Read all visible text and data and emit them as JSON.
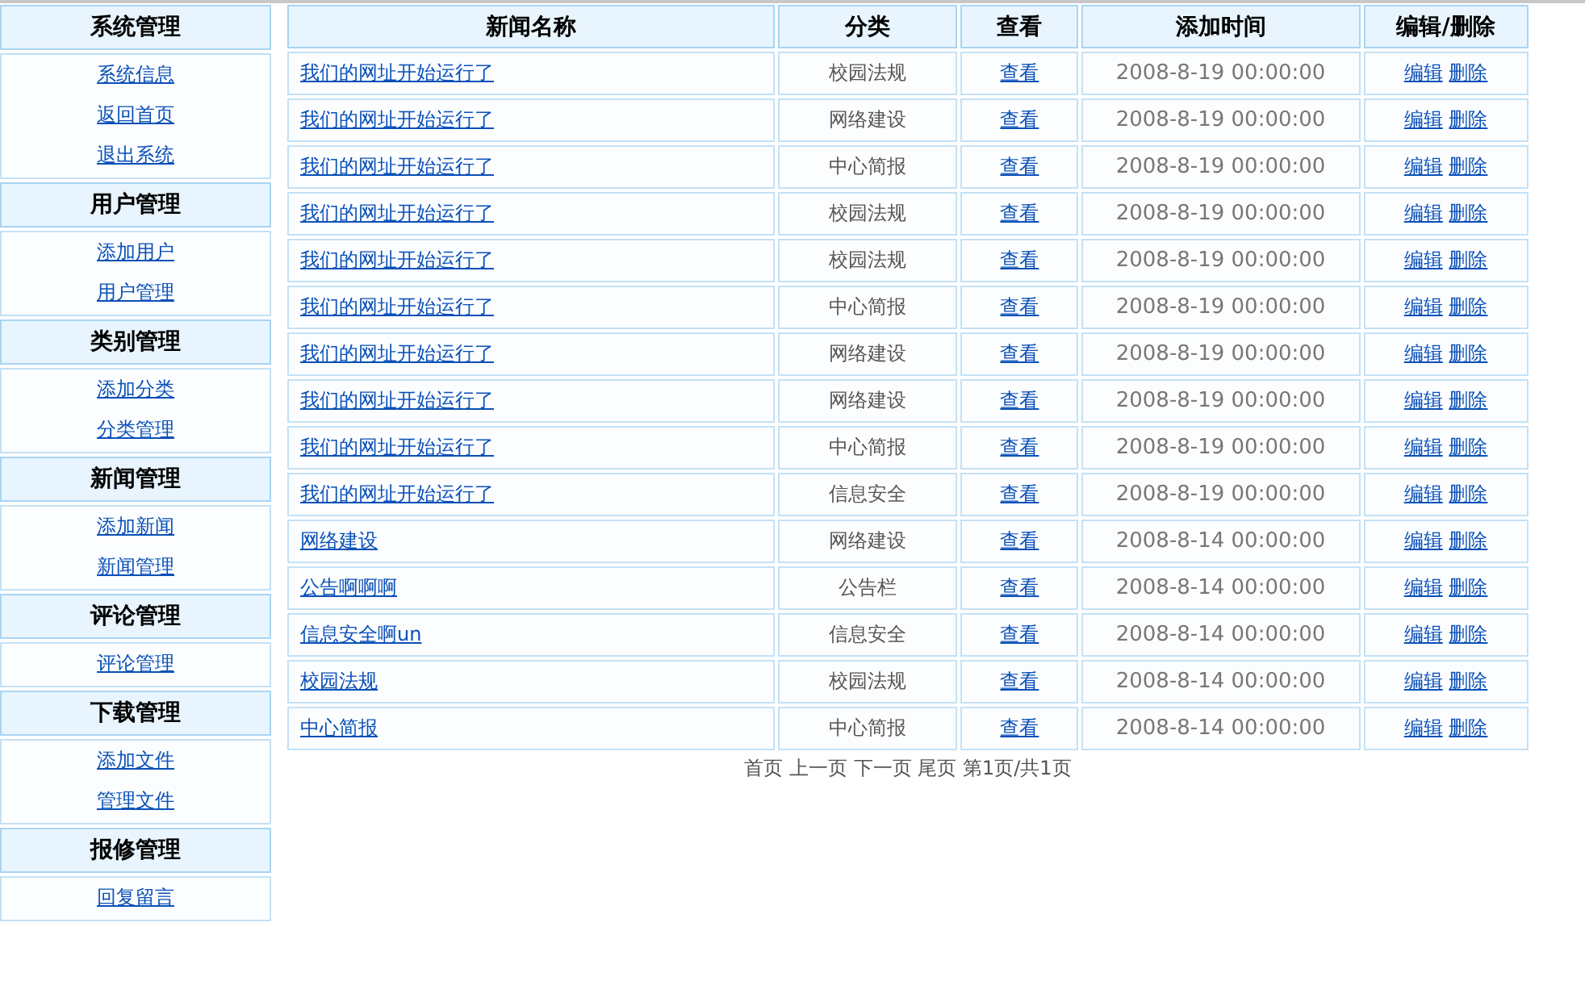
{
  "sidebar": {
    "sections": [
      {
        "title": "系统管理",
        "links": [
          "系统信息",
          "返回首页",
          "退出系统"
        ]
      },
      {
        "title": "用户管理",
        "links": [
          "添加用户",
          "用户管理"
        ]
      },
      {
        "title": "类别管理",
        "links": [
          "添加分类",
          "分类管理"
        ]
      },
      {
        "title": "新闻管理",
        "links": [
          "添加新闻",
          "新闻管理"
        ]
      },
      {
        "title": "评论管理",
        "links": [
          "评论管理"
        ]
      },
      {
        "title": "下载管理",
        "links": [
          "添加文件",
          "管理文件"
        ]
      },
      {
        "title": "报修管理",
        "links": [
          "回复留言"
        ]
      }
    ]
  },
  "table": {
    "columns": [
      "新闻名称",
      "分类",
      "查看",
      "添加时间",
      "编辑/删除"
    ],
    "rows": [
      {
        "title": "我们的网址开始运行了",
        "category": "校园法规",
        "view": "查看",
        "time": "2008-8-19 00:00:00",
        "edit": "编辑",
        "delete": "删除"
      },
      {
        "title": "我们的网址开始运行了",
        "category": "网络建设",
        "view": "查看",
        "time": "2008-8-19 00:00:00",
        "edit": "编辑",
        "delete": "删除"
      },
      {
        "title": "我们的网址开始运行了",
        "category": "中心简报",
        "view": "查看",
        "time": "2008-8-19 00:00:00",
        "edit": "编辑",
        "delete": "删除"
      },
      {
        "title": "我们的网址开始运行了",
        "category": "校园法规",
        "view": "查看",
        "time": "2008-8-19 00:00:00",
        "edit": "编辑",
        "delete": "删除"
      },
      {
        "title": "我们的网址开始运行了",
        "category": "校园法规",
        "view": "查看",
        "time": "2008-8-19 00:00:00",
        "edit": "编辑",
        "delete": "删除"
      },
      {
        "title": "我们的网址开始运行了",
        "category": "中心简报",
        "view": "查看",
        "time": "2008-8-19 00:00:00",
        "edit": "编辑",
        "delete": "删除"
      },
      {
        "title": "我们的网址开始运行了",
        "category": "网络建设",
        "view": "查看",
        "time": "2008-8-19 00:00:00",
        "edit": "编辑",
        "delete": "删除"
      },
      {
        "title": "我们的网址开始运行了",
        "category": "网络建设",
        "view": "查看",
        "time": "2008-8-19 00:00:00",
        "edit": "编辑",
        "delete": "删除"
      },
      {
        "title": "我们的网址开始运行了",
        "category": "中心简报",
        "view": "查看",
        "time": "2008-8-19 00:00:00",
        "edit": "编辑",
        "delete": "删除"
      },
      {
        "title": "我们的网址开始运行了",
        "category": "信息安全",
        "view": "查看",
        "time": "2008-8-19 00:00:00",
        "edit": "编辑",
        "delete": "删除"
      },
      {
        "title": "网络建设",
        "category": "网络建设",
        "view": "查看",
        "time": "2008-8-14 00:00:00",
        "edit": "编辑",
        "delete": "删除"
      },
      {
        "title": "公告啊啊啊",
        "category": "公告栏",
        "view": "查看",
        "time": "2008-8-14 00:00:00",
        "edit": "编辑",
        "delete": "删除"
      },
      {
        "title": "信息安全啊un",
        "category": "信息安全",
        "view": "查看",
        "time": "2008-8-14 00:00:00",
        "edit": "编辑",
        "delete": "删除"
      },
      {
        "title": "校园法规",
        "category": "校园法规",
        "view": "查看",
        "time": "2008-8-14 00:00:00",
        "edit": "编辑",
        "delete": "删除"
      },
      {
        "title": "中心简报",
        "category": "中心简报",
        "view": "查看",
        "time": "2008-8-14 00:00:00",
        "edit": "编辑",
        "delete": "删除"
      }
    ]
  },
  "pagination": "首页 上一页 下一页 尾页 第1页/共1页"
}
